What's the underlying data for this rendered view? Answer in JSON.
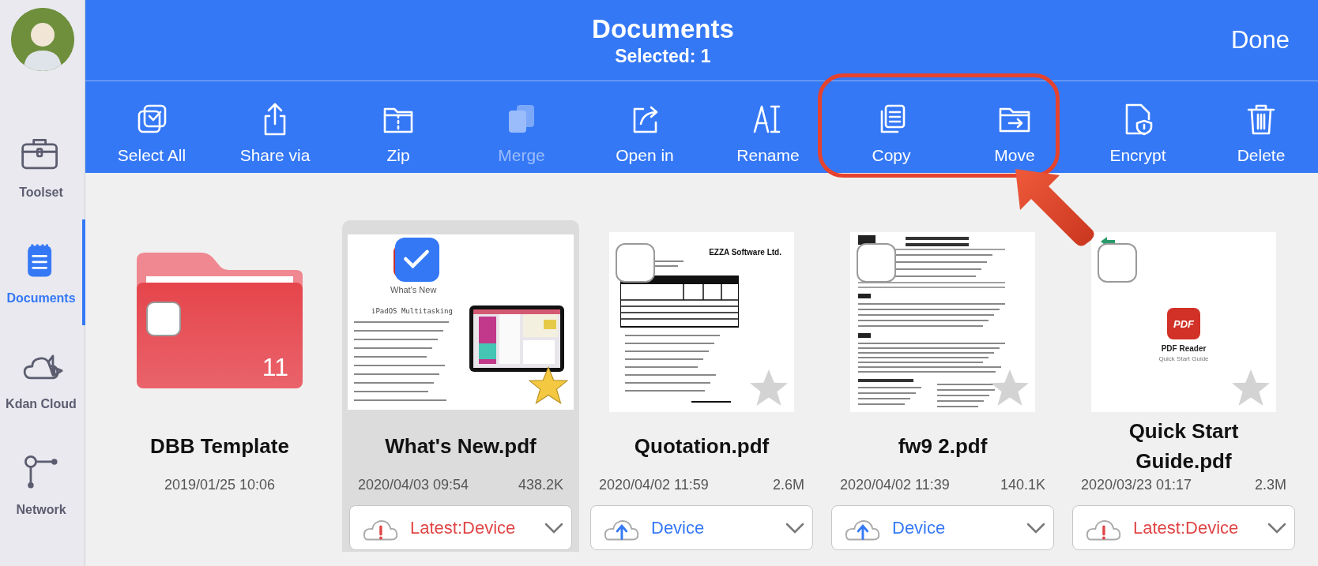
{
  "sidebar": {
    "items": [
      {
        "label": "Toolset",
        "selected": false
      },
      {
        "label": "Documents",
        "selected": true
      },
      {
        "label": "Kdan Cloud",
        "selected": false
      },
      {
        "label": "Network",
        "selected": false
      }
    ]
  },
  "header": {
    "title": "Documents",
    "subtitle": "Selected: 1",
    "done": "Done"
  },
  "toolbar": [
    {
      "label": "Select All",
      "disabled": false
    },
    {
      "label": "Share via",
      "disabled": false
    },
    {
      "label": "Zip",
      "disabled": false
    },
    {
      "label": "Merge",
      "disabled": true
    },
    {
      "label": "Open in",
      "disabled": false
    },
    {
      "label": "Rename",
      "disabled": false
    },
    {
      "label": "Copy",
      "disabled": false
    },
    {
      "label": "Move",
      "disabled": false
    },
    {
      "label": "Encrypt",
      "disabled": false
    },
    {
      "label": "Delete",
      "disabled": false
    }
  ],
  "files": [
    {
      "kind": "folder",
      "name": "DBB Template",
      "date": "2019/01/25 10:06",
      "count": "11",
      "selected": false,
      "checked": false
    },
    {
      "kind": "pdf",
      "name": "What's New.pdf",
      "date": "2020/04/03 09:54",
      "size": "438.2K",
      "selected": true,
      "checked": true,
      "starred": true,
      "thumbnail": {
        "kind": "whatsnew",
        "texts": [
          "What's New",
          "iPadOS Multitasking"
        ]
      },
      "sync": {
        "kind": "alert",
        "label": "Latest:Device"
      }
    },
    {
      "kind": "pdf",
      "name": "Quotation.pdf",
      "date": "2020/04/02 11:59",
      "size": "2.6M",
      "selected": false,
      "checked": false,
      "starred": false,
      "thumbnail": {
        "kind": "invoice",
        "texts": [
          "EZZA Software Ltd."
        ]
      },
      "sync": {
        "kind": "upload",
        "label": "Device"
      }
    },
    {
      "kind": "pdf",
      "name": "fw9 2.pdf",
      "date": "2020/04/02 11:39",
      "size": "140.1K",
      "selected": false,
      "checked": false,
      "starred": false,
      "thumbnail": {
        "kind": "form"
      },
      "sync": {
        "kind": "upload",
        "label": "Device"
      }
    },
    {
      "kind": "pdf",
      "name": "Quick Start Guide.pdf",
      "date": "2020/03/23 01:17",
      "size": "2.3M",
      "selected": false,
      "checked": false,
      "starred": false,
      "thumbnail": {
        "kind": "guide",
        "texts": [
          "PDF",
          "PDF Reader",
          "Quick Start Guide"
        ]
      },
      "sync": {
        "kind": "alert",
        "label": "Latest:Device"
      }
    }
  ]
}
